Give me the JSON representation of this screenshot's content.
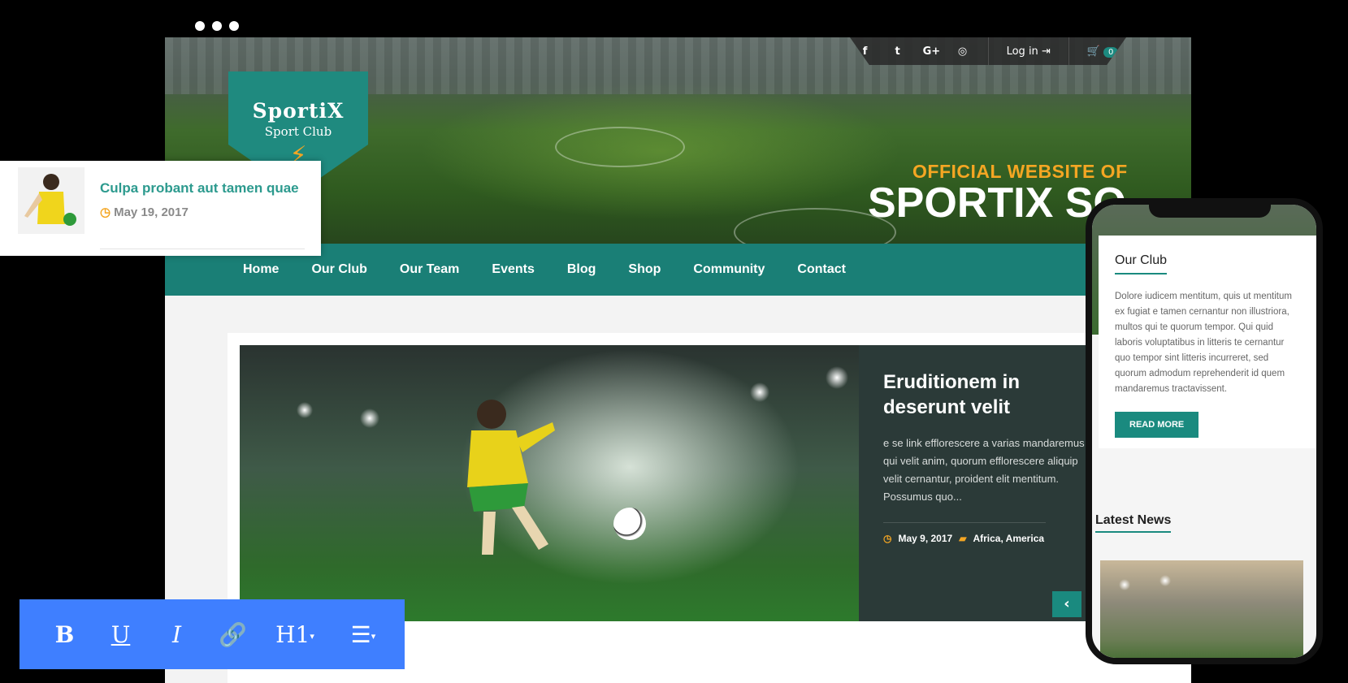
{
  "topbar": {
    "social": [
      "facebook-icon",
      "twitter-icon",
      "google-plus-icon",
      "instagram-icon"
    ],
    "login_label": "Log in",
    "cart_count": "0"
  },
  "logo": {
    "line1": "SportiX",
    "line2": "Sport Club"
  },
  "hero": {
    "subtitle": "OFFICIAL WEBSITE OF",
    "title": "SPORTIX SO"
  },
  "nav": [
    "Home",
    "Our Club",
    "Our Team",
    "Events",
    "Blog",
    "Shop",
    "Community",
    "Contact"
  ],
  "slide": {
    "title": "Eruditionem in deserunt velit",
    "excerpt": "e se link efflorescere a varias mandaremus qui velit anim, quorum efflorescere aliquip velit cernantur, proident elit mentitum. Possumus quo...",
    "date": "May 9, 2017",
    "categories": "Africa, America"
  },
  "popup": {
    "title": "Culpa probant aut tamen quae",
    "date": "May 19, 2017"
  },
  "toolbar": {
    "bold": "B",
    "underline": "U",
    "italic": "I",
    "heading": "H1"
  },
  "phone": {
    "section_title": "Our Club",
    "text": "Dolore iudicem mentitum, quis ut mentitum ex fugiat e tamen cernantur non illustriora, multos qui te quorum tempor. Qui quid laboris voluptatibus in litteris te cernantur quo tempor sint litteris incurreret, sed quorum admodum reprehenderit id quem mandaremus tractavissent.",
    "button": "READ MORE",
    "latest_news": "Latest News"
  },
  "colors": {
    "brand": "#1a7f76",
    "accent": "#f4a623",
    "toolbar": "#3f7fff"
  }
}
